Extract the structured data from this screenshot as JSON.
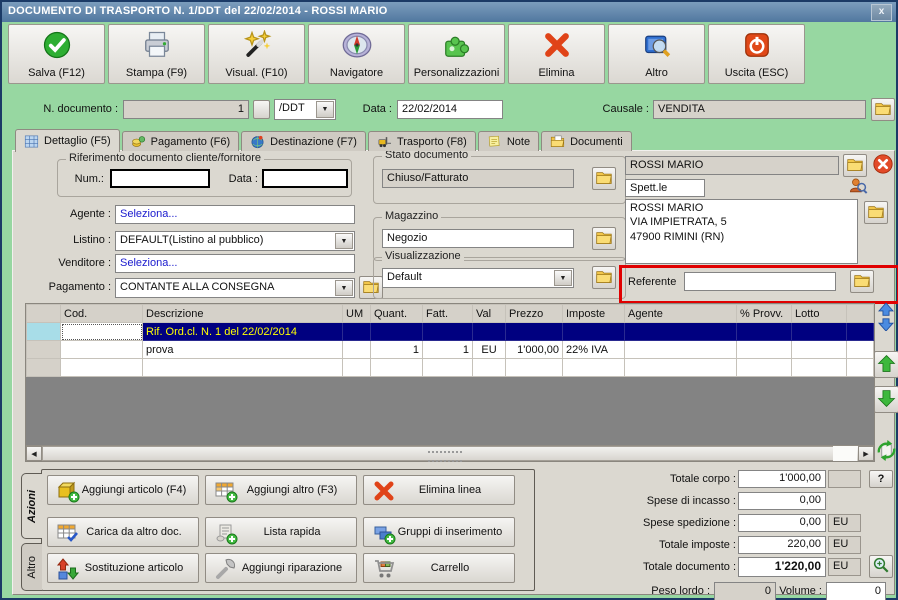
{
  "window": {
    "title": "DOCUMENTO DI TRASPORTO N. 1/DDT del 22/02/2014 - ROSSI MARIO",
    "close": "x"
  },
  "toolbar": {
    "buttons": [
      "Salva (F12)",
      "Stampa (F9)",
      "Visual. (F10)",
      "Navigatore",
      "Personalizzazioni",
      "Elimina",
      "Altro",
      "Uscita (ESC)"
    ]
  },
  "docbar": {
    "n_label": "N. documento :",
    "n_value": "1",
    "type_value": "/DDT",
    "date_label": "Data :",
    "date_value": "22/02/2014",
    "causale_label": "Causale :",
    "causale_value": "VENDITA"
  },
  "tabs": [
    "Dettaglio (F5)",
    "Pagamento (F6)",
    "Destinazione (F7)",
    "Trasporto (F8)",
    "Note",
    "Documenti"
  ],
  "left": {
    "rif_legend": "Riferimento documento cliente/fornitore",
    "num_label": "Num.:",
    "num_value": "",
    "data_label": "Data :",
    "data_value": "",
    "agente_label": "Agente :",
    "agente_value": "Seleziona...",
    "listino_label": "Listino :",
    "listino_value": "DEFAULT(Listino al pubblico)",
    "venditore_label": "Venditore :",
    "venditore_value": "Seleziona...",
    "pagamento_label": "Pagamento :",
    "pagamento_value": "CONTANTE ALLA CONSEGNA"
  },
  "mid": {
    "stato_legend": "Stato documento",
    "stato_value": "Chiuso/Fatturato",
    "magazzino_legend": "Magazzino",
    "magazzino_value": "Negozio",
    "visualizzazione_legend": "Visualizzazione",
    "visualizzazione_value": "Default"
  },
  "cliente": {
    "nome": "ROSSI MARIO",
    "titolo": "Spett.le",
    "indirizzo": "ROSSI MARIO\nVIA IMPIETRATA, 5\n47900 RIMINI (RN)",
    "referente_label": "Referente",
    "referente_value": ""
  },
  "grid": {
    "headers": [
      "",
      "Cod.",
      "Descrizione",
      "UM",
      "Quant.",
      "Fatt.",
      "Val",
      "Prezzo",
      "Imposte",
      "Agente",
      "% Provv.",
      "Lotto"
    ],
    "rows": [
      {
        "cells": [
          "",
          "",
          "Rif. Ord.cl. N. 1 del 22/02/2014",
          "",
          "",
          "",
          "",
          "",
          "",
          "",
          "",
          ""
        ]
      },
      {
        "cells": [
          "",
          "",
          "prova",
          "",
          "1",
          "1",
          "EU",
          "1'000,00",
          "22% IVA",
          "",
          "",
          ""
        ]
      },
      {
        "cells": [
          "",
          "",
          "",
          "",
          "",
          "",
          "",
          "",
          "",
          "",
          "",
          ""
        ]
      }
    ]
  },
  "actions": {
    "tab_azioni": "Azioni",
    "tab_altro": "Altro",
    "buttons": [
      "Aggiungi articolo (F4)",
      "Aggiungi altro (F3)",
      "Elimina linea",
      "Carica da altro doc.",
      "Lista rapida",
      "Gruppi di inserimento",
      "Sostituzione articolo",
      "Aggiungi riparazione",
      "Carrello"
    ]
  },
  "totals": {
    "rows": [
      {
        "label": "Totale corpo :",
        "value": "1'000,00",
        "unit": ""
      },
      {
        "label": "Spese di incasso :",
        "value": "0,00"
      },
      {
        "label": "Spese spedizione :",
        "value": "0,00",
        "unit": "EU"
      },
      {
        "label": "Totale imposte :",
        "value": "220,00",
        "unit": "EU"
      },
      {
        "label": "Totale documento :",
        "value": "1'220,00",
        "unit": "EU"
      }
    ],
    "help_label": "?",
    "peso_label": "Peso lordo :",
    "peso_value": "0",
    "volume_label": "Volume :",
    "volume_value": "0"
  },
  "colors": {
    "accent_green": "#97d7a1",
    "title_blue": "#51779f",
    "selected_row": "#000080",
    "selected_text": "#ffff00",
    "highlight_red": "#e00000"
  }
}
